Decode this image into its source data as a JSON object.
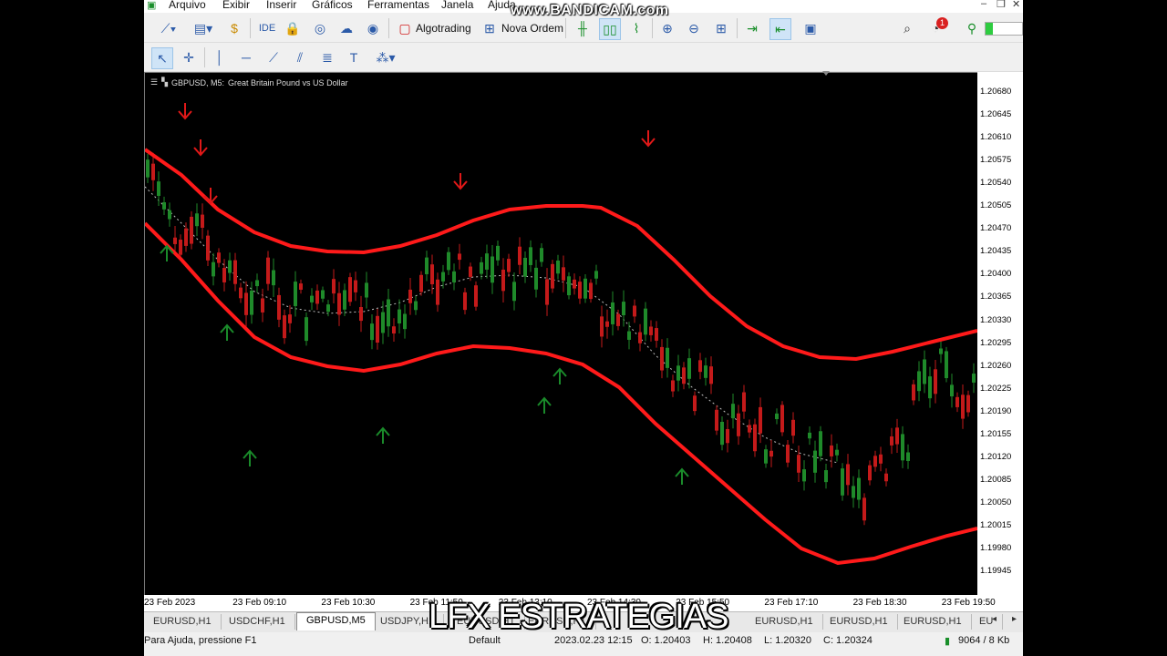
{
  "menu": [
    "Arquivo",
    "Exibir",
    "Inserir",
    "Gráficos",
    "Ferramentas",
    "Janela",
    "Ajuda"
  ],
  "watermark": "www.BANDICAM.com",
  "toolbar": {
    "ide_label": "IDE",
    "algotrading_label": "Algotrading",
    "new_order_label": "Nova Ordem",
    "notification_count": "1"
  },
  "chart": {
    "symbol": "GBPUSD, M5:",
    "description": "Great Britain Pound vs US Dollar"
  },
  "price_axis": [
    "1.20680",
    "1.20645",
    "1.20610",
    "1.20575",
    "1.20540",
    "1.20505",
    "1.20470",
    "1.20435",
    "1.20400",
    "1.20365",
    "1.20330",
    "1.20295",
    "1.20260",
    "1.20225",
    "1.20190",
    "1.20155",
    "1.20120",
    "1.20085",
    "1.20050",
    "1.20015",
    "1.19980",
    "1.19945"
  ],
  "time_axis": [
    "23 Feb 2023",
    "23 Feb 09:10",
    "23 Feb 10:30",
    "23 Feb 11:50",
    "23 Feb 13:10",
    "23 Feb 14:30",
    "23 Feb 15:50",
    "23 Feb 17:10",
    "23 Feb 18:30",
    "23 Feb 19:50"
  ],
  "tabs": [
    "EURUSD,H1",
    "USDCHF,H1",
    "GBPUSD,M5",
    "USDJPY,H1",
    "EURUSD,H1",
    "EURUSD,H1",
    "EURUSD,H1",
    "EURUSD,H1",
    "EURUSD,H1",
    "EU"
  ],
  "active_tab": "GBPUSD,M5",
  "status": {
    "help": "Para Ajuda, pressione F1",
    "profile": "Default",
    "datetime": "2023.02.23 12:15",
    "open": "O: 1.20403",
    "high": "H: 1.20408",
    "low": "L: 1.20320",
    "close": "C: 1.20324",
    "traffic": "9064 / 8 Kb"
  },
  "overlay_caption": "LFX ESTRATEGIAS",
  "colors": {
    "bull": "#1f8a2a",
    "bear": "#c41a1a",
    "band": "#ff1a1a",
    "arrow_up": "#1a8a2a",
    "arrow_down": "#e01818"
  }
}
